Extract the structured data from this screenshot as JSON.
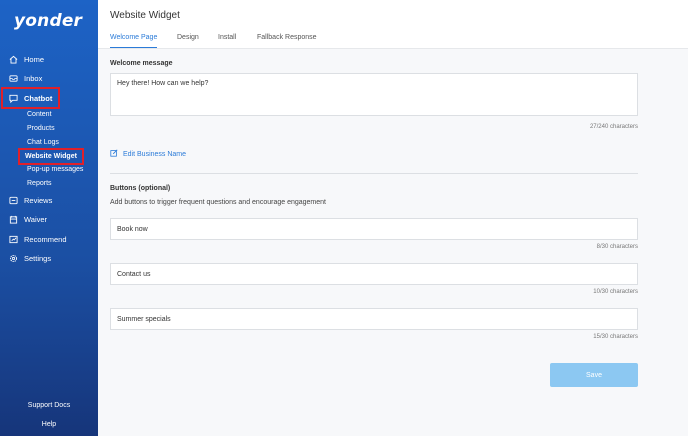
{
  "app": {
    "logo": "yonder"
  },
  "sidebar": {
    "items": [
      {
        "label": "Home",
        "icon": "home-icon"
      },
      {
        "label": "Inbox",
        "icon": "inbox-icon"
      },
      {
        "label": "Chatbot",
        "icon": "chat-icon"
      },
      {
        "label": "Reviews",
        "icon": "reviews-icon"
      },
      {
        "label": "Waiver",
        "icon": "waiver-icon"
      },
      {
        "label": "Recommend",
        "icon": "recommend-icon"
      },
      {
        "label": "Settings",
        "icon": "gear-icon"
      }
    ],
    "chatbot_sub": [
      {
        "label": "Content"
      },
      {
        "label": "Products"
      },
      {
        "label": "Chat Logs"
      },
      {
        "label": "Website Widget"
      },
      {
        "label": "Pop-up messages"
      },
      {
        "label": "Reports"
      }
    ],
    "bottom": {
      "support": "Support Docs",
      "help": "Help"
    }
  },
  "header": {
    "title": "Website Widget",
    "tabs": [
      {
        "label": "Welcome Page",
        "active": true
      },
      {
        "label": "Design"
      },
      {
        "label": "Install"
      },
      {
        "label": "Fallback Response"
      }
    ]
  },
  "welcome": {
    "label": "Welcome message",
    "value": "Hey there! How can we help?",
    "counter": "27/240 characters"
  },
  "edit_business": {
    "label": "Edit Business Name"
  },
  "buttons_section": {
    "label": "Buttons (optional)",
    "description": "Add buttons to trigger frequent questions and encourage engagement",
    "items": [
      {
        "value": "Book now",
        "counter": "8/30 characters"
      },
      {
        "value": "Contact us",
        "counter": "10/30 characters"
      },
      {
        "value": "Summer specials",
        "counter": "15/30 characters"
      }
    ]
  },
  "save": {
    "label": "Save"
  },
  "colors": {
    "accent": "#2b7bd8",
    "sidebar": "#1d5fbf",
    "highlight": "#e0202a",
    "save_disabled": "#8cc8f2"
  }
}
